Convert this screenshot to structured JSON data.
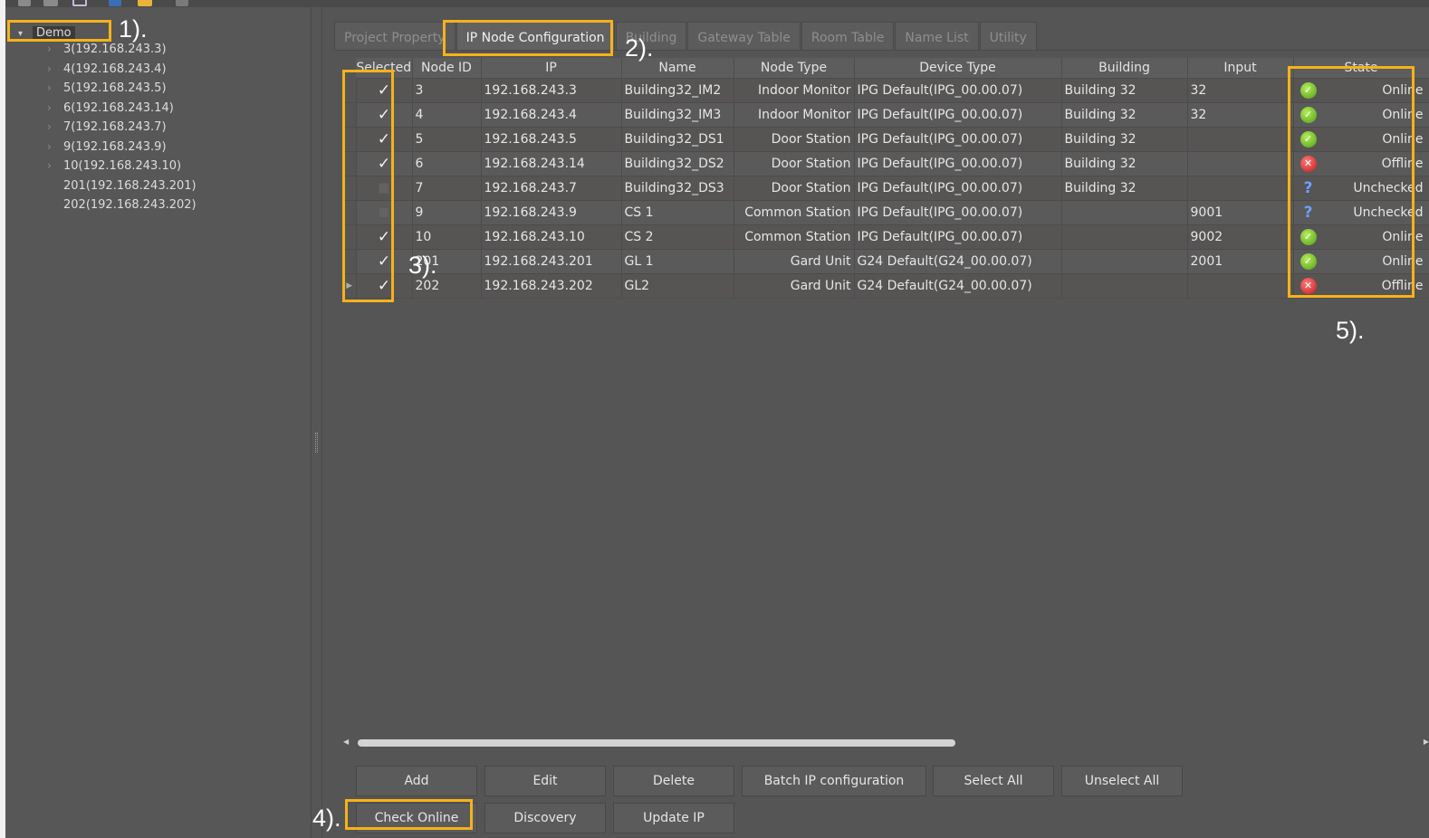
{
  "tree": {
    "root": "Demo",
    "items": [
      {
        "label": "3(192.168.243.3)",
        "expandable": true
      },
      {
        "label": "4(192.168.243.4)",
        "expandable": true
      },
      {
        "label": "5(192.168.243.5)",
        "expandable": true
      },
      {
        "label": "6(192.168.243.14)",
        "expandable": true
      },
      {
        "label": "7(192.168.243.7)",
        "expandable": true
      },
      {
        "label": "9(192.168.243.9)",
        "expandable": true
      },
      {
        "label": "10(192.168.243.10)",
        "expandable": true
      },
      {
        "label": "201(192.168.243.201)",
        "expandable": false
      },
      {
        "label": "202(192.168.243.202)",
        "expandable": false
      }
    ]
  },
  "tabs": [
    "Project Property",
    "IP Node Configuration",
    "Building",
    "Gateway Table",
    "Room Table",
    "Name List",
    "Utility"
  ],
  "table": {
    "headers": [
      "Selected",
      "Node ID",
      "IP",
      "Name",
      "Node Type",
      "Device Type",
      "Building",
      "Input",
      "State"
    ],
    "rows": [
      {
        "selected": true,
        "node_id": "3",
        "ip": "192.168.243.3",
        "name": "Building32_IM2",
        "node_type": "Indoor Monitor",
        "device_type": "IPG Default(IPG_00.00.07)",
        "building": "Building 32",
        "input": "32",
        "state": "Online"
      },
      {
        "selected": true,
        "node_id": "4",
        "ip": "192.168.243.4",
        "name": "Building32_IM3",
        "node_type": "Indoor Monitor",
        "device_type": "IPG Default(IPG_00.00.07)",
        "building": "Building 32",
        "input": "32",
        "state": "Online"
      },
      {
        "selected": true,
        "node_id": "5",
        "ip": "192.168.243.5",
        "name": "Building32_DS1",
        "node_type": "Door Station",
        "device_type": "IPG Default(IPG_00.00.07)",
        "building": "Building 32",
        "input": "",
        "state": "Online"
      },
      {
        "selected": true,
        "node_id": "6",
        "ip": "192.168.243.14",
        "name": "Building32_DS2",
        "node_type": "Door Station",
        "device_type": "IPG Default(IPG_00.00.07)",
        "building": "Building 32",
        "input": "",
        "state": "Offline"
      },
      {
        "selected": false,
        "node_id": "7",
        "ip": "192.168.243.7",
        "name": "Building32_DS3",
        "node_type": "Door Station",
        "device_type": "IPG Default(IPG_00.00.07)",
        "building": "Building 32",
        "input": "",
        "state": "Unchecked"
      },
      {
        "selected": false,
        "node_id": "9",
        "ip": "192.168.243.9",
        "name": "CS 1",
        "node_type": "Common Station",
        "device_type": "IPG Default(IPG_00.00.07)",
        "building": "",
        "input": "9001",
        "state": "Unchecked"
      },
      {
        "selected": true,
        "node_id": "10",
        "ip": "192.168.243.10",
        "name": "CS 2",
        "node_type": "Common Station",
        "device_type": "IPG Default(IPG_00.00.07)",
        "building": "",
        "input": "9002",
        "state": "Online"
      },
      {
        "selected": true,
        "node_id": "201",
        "ip": "192.168.243.201",
        "name": "GL 1",
        "node_type": "Gard Unit",
        "device_type": "G24 Default(G24_00.00.07)",
        "building": "",
        "input": "2001",
        "state": "Online"
      },
      {
        "selected": true,
        "node_id": "202",
        "ip": "192.168.243.202",
        "name": "GL2",
        "node_type": "Gard Unit",
        "device_type": "G24 Default(G24_00.00.07)",
        "building": "",
        "input": "",
        "state": "Offline"
      }
    ]
  },
  "buttons": {
    "add": "Add",
    "edit": "Edit",
    "delete": "Delete",
    "batch_ip": "Batch IP configuration",
    "select_all": "Select All",
    "unselect_all": "Unselect All",
    "check_online": "Check Online",
    "discovery": "Discovery",
    "update_ip": "Update IP"
  },
  "annotations": {
    "a1": "1).",
    "a2": "2).",
    "a3": "3).",
    "a4": "4).",
    "a5": "5)."
  },
  "colors": {
    "highlight": "#f5b21a",
    "online": "#5cb82a",
    "offline": "#d42020",
    "unchecked": "#6aa2ff"
  }
}
